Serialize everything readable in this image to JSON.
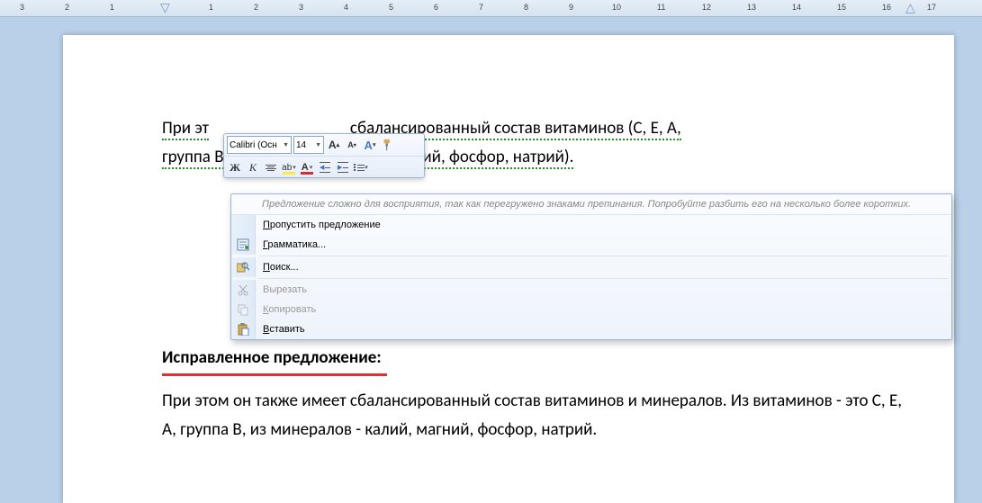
{
  "ruler": {
    "marks": [
      -3,
      -2,
      -1,
      1,
      2,
      3,
      4,
      5,
      6,
      7,
      8,
      9,
      10,
      11,
      12,
      13,
      14,
      15,
      16,
      17
    ]
  },
  "doc": {
    "para1_a": "При эт",
    "para1_b": " сбалансированный состав витаминов (С, Е, А,",
    "para1_c": "группа В) и минералов (калий, магний, фосфор, натрий).",
    "heading": "Исправленное предложение:",
    "para2": "При этом он также имеет сбалансированный состав витаминов и минералов. Из витаминов - это С, Е, А, группа В, из минералов - калий, магний, фосфор, натрий."
  },
  "mini_toolbar": {
    "font_name": "Calibri (Осн",
    "font_size": "14",
    "grow": "A",
    "shrink": "A",
    "bold": "Ж",
    "italic": "К",
    "highlight": "ab",
    "fontcolor": "A"
  },
  "ctx": {
    "note": "Предложение сложно для восприятия, так как перегружено знаками препинания. Попробуйте разбить его на несколько более коротких.",
    "skip": "Пропустить предложение",
    "grammar": "Грамматика...",
    "find": "Поиск...",
    "cut": "Вырезать",
    "copy": "Копировать",
    "paste": "Вставить"
  }
}
